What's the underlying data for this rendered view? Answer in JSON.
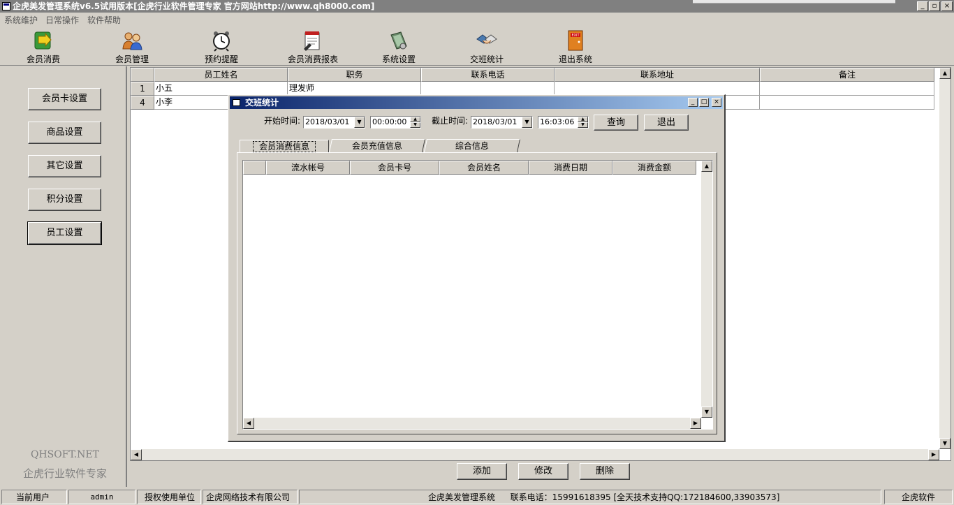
{
  "window": {
    "title": "企虎美发管理系统v6.5试用版本[企虎行业软件管理专家 官方网站http://www.qh8000.com]",
    "controls": [
      "_",
      "▫",
      "×"
    ]
  },
  "menu": [
    "系统维护",
    "日常操作",
    "软件帮助"
  ],
  "toolbar": [
    {
      "label": "会员消费",
      "icon": "member-consume-icon"
    },
    {
      "label": "会员管理",
      "icon": "member-manage-icon"
    },
    {
      "label": "预约提醒",
      "icon": "alarm-clock-icon"
    },
    {
      "label": "会员消费报表",
      "icon": "report-icon"
    },
    {
      "label": "系统设置",
      "icon": "settings-book-icon"
    },
    {
      "label": "交班统计",
      "icon": "handshake-icon"
    },
    {
      "label": "退出系统",
      "icon": "exit-door-icon"
    }
  ],
  "exit_sign": "EXIT",
  "sidebar": {
    "buttons": [
      "会员卡设置",
      "商品设置",
      "其它设置",
      "积分设置",
      "员工设置"
    ],
    "brand_en": "QHSOFT.NET",
    "brand_cn": "企虎行业软件专家"
  },
  "employee_grid": {
    "columns": [
      "员工姓名",
      "职务",
      "联系电话",
      "联系地址",
      "备注"
    ],
    "rows": [
      {
        "no": "1",
        "name": "小五",
        "role": "理发师",
        "phone": "",
        "address": "",
        "note": ""
      },
      {
        "no": "4",
        "name": "小李",
        "role": "",
        "phone": "",
        "address": "",
        "note": ""
      }
    ]
  },
  "actions": [
    "添加",
    "修改",
    "删除"
  ],
  "statusbar": {
    "user_label": "当前用户",
    "user_value": "admin",
    "license_label": "授权使用单位",
    "license_value": "企虎网络技术有限公司",
    "system_name": "企虎美发管理系统",
    "contact": "联系电话：15991618395 [全天技术支持QQ:172184600,33903573]",
    "vendor": "企虎软件"
  },
  "dialog": {
    "title": "交班统计",
    "start_label": "开始时间:",
    "start_date": "2018/03/01",
    "start_time": "00:00:00",
    "end_label": "截止时间:",
    "end_date": "2018/03/01",
    "end_time": "16:03:06",
    "query_button": "查询",
    "exit_button": "退出",
    "tabs": [
      "会员消费信息",
      "会员充值信息",
      "综合信息"
    ],
    "active_tab": "会员消费信息",
    "columns": [
      "流水帐号",
      "会员卡号",
      "会员姓名",
      "消费日期",
      "消费金额"
    ],
    "rows": []
  },
  "colors": {
    "face": "#d4d0c8",
    "dialog_title_start": "#0a246a",
    "dialog_title_end": "#a6caf0",
    "inactive_title": "#808080"
  }
}
